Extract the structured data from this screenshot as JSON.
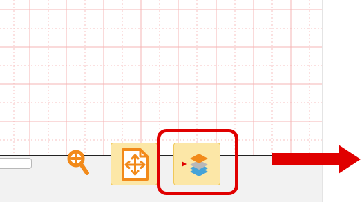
{
  "screen": {
    "accent_red": "#e00000",
    "grid_line_color": "#f6b4b4",
    "toolbar_background": "#f2f2f2",
    "tool_button_background": "#fce7a7",
    "tool_button_border": "#f0c85a",
    "icon_orange": "#f28a1a",
    "icon_blue": "#45a3d8"
  },
  "toolbar": {
    "zoom_icon": "magnifier-plus-icon",
    "fit_icon": "fit-to-page-icon",
    "layers_icon": "layers-icon",
    "layers_expand_icon": "triangle-right-icon"
  },
  "annotation": {
    "highlight": "layers-button",
    "arrow_direction": "right"
  }
}
